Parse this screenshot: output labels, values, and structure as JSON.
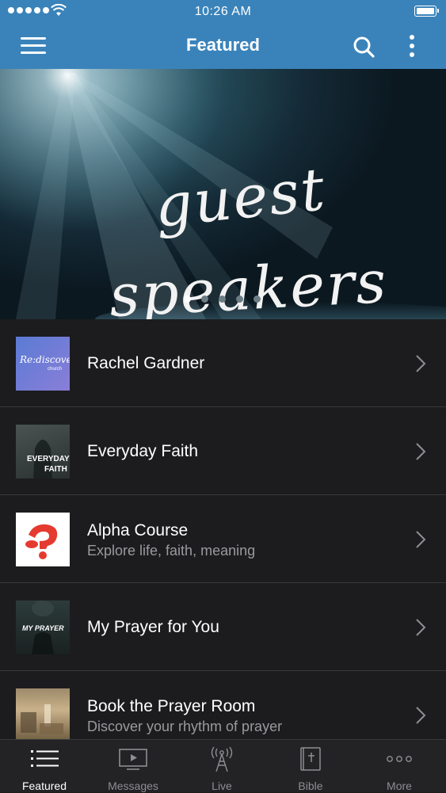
{
  "status_bar": {
    "time": "10:26 AM"
  },
  "nav": {
    "title": "Featured"
  },
  "hero": {
    "line1": "guest",
    "line2": "speakers",
    "slide_count": 5,
    "active_slide": 1
  },
  "items": [
    {
      "title": "Rachel Gardner",
      "subtitle": "",
      "thumb_text": "Re:discover",
      "thumb_sub": "church"
    },
    {
      "title": "Everyday Faith",
      "subtitle": "",
      "thumb_text": "EVERYDAY",
      "thumb_sub": "FAITH"
    },
    {
      "title": "Alpha Course",
      "subtitle": "Explore life, faith, meaning"
    },
    {
      "title": "My Prayer for You",
      "subtitle": "",
      "thumb_text": "MY PRAYER"
    },
    {
      "title": "Book the Prayer Room",
      "subtitle": "Discover your rhythm of prayer"
    }
  ],
  "tabs": [
    {
      "label": "Featured",
      "icon": "list-icon",
      "active": true
    },
    {
      "label": "Messages",
      "icon": "video-icon",
      "active": false
    },
    {
      "label": "Live",
      "icon": "broadcast-icon",
      "active": false
    },
    {
      "label": "Bible",
      "icon": "bible-icon",
      "active": false
    },
    {
      "label": "More",
      "icon": "more-dots-icon",
      "active": false
    }
  ],
  "colors": {
    "nav_bar": "#3a83ba",
    "background": "#1c1c1e",
    "alpha_red": "#e53a30"
  }
}
